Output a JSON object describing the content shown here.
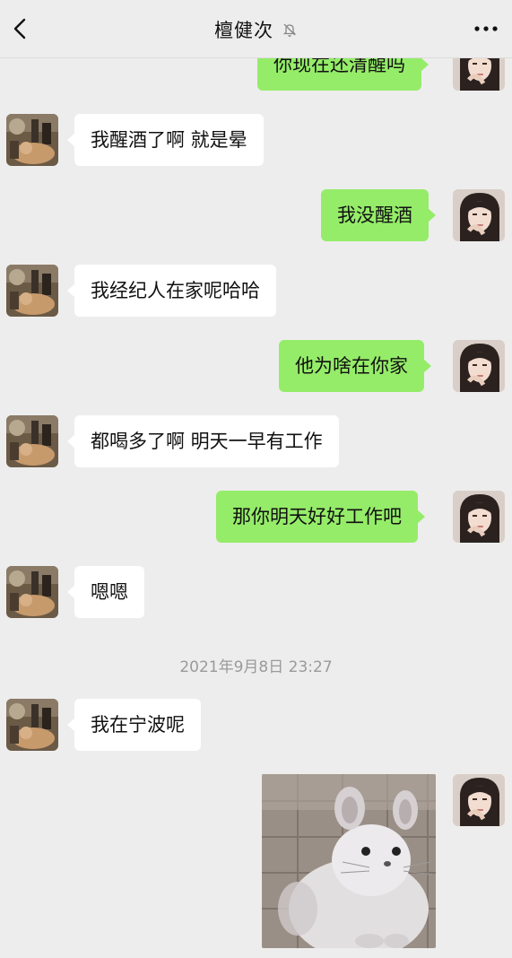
{
  "header": {
    "title": "檀健次",
    "back_icon": "chevron-left-icon",
    "mute_icon": "bell-off-icon",
    "more_icon": "ellipsis-icon"
  },
  "messages": [
    {
      "sender": "me",
      "text": "你现在还清醒吗"
    },
    {
      "sender": "them",
      "text": "我醒酒了啊 就是晕"
    },
    {
      "sender": "me",
      "text": "我没醒酒"
    },
    {
      "sender": "them",
      "text": "我经纪人在家呢哈哈"
    },
    {
      "sender": "me",
      "text": "他为啥在你家"
    },
    {
      "sender": "them",
      "text": "都喝多了啊 明天一早有工作"
    },
    {
      "sender": "me",
      "text": "那你明天好好工作吧"
    },
    {
      "sender": "them",
      "text": "嗯嗯"
    },
    {
      "sender": "them",
      "text": "我在宁波呢"
    },
    {
      "sender": "me",
      "type": "sticker",
      "sticker": "chinchilla-sticker"
    }
  ],
  "timestamp": "2021年9月8日 23:27",
  "colors": {
    "background": "#ededed",
    "my_bubble": "#95ec69",
    "their_bubble": "#ffffff",
    "timestamp_text": "#9a9a9a"
  }
}
